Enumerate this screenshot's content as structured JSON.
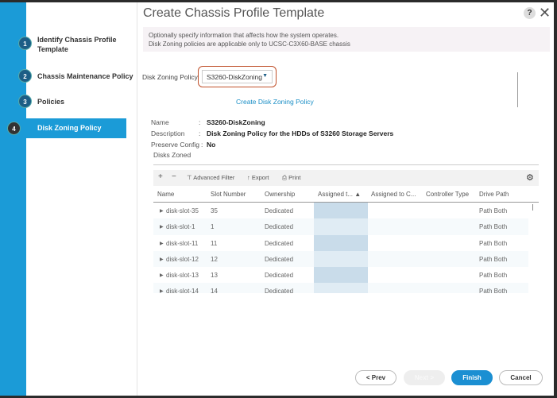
{
  "title": "Create Chassis Profile Template",
  "steps": [
    {
      "num": "1",
      "label": "Identify Chassis Profile Template"
    },
    {
      "num": "2",
      "label": "Chassis Maintenance Policy"
    },
    {
      "num": "3",
      "label": "Policies"
    },
    {
      "num": "4",
      "label": "Disk Zoning Policy"
    }
  ],
  "info": [
    "Optionally specify information that affects how the system operates.",
    "Disk Zoning policies are applicable only to UCSC-C3X60-BASE chassis"
  ],
  "dz_label": "Disk Zoning Policy",
  "dz_value": "S3260-DiskZoning",
  "create_link": "Create Disk Zoning Policy",
  "props": {
    "name_label": "Name",
    "name": "S3260-DiskZoning",
    "desc_label": "Description",
    "desc": "Disk Zoning Policy for the HDDs of S3260 Storage Servers",
    "preserve_label": "Preserve Config",
    "preserve": "No"
  },
  "disks_zoned": "Disks Zoned",
  "toolbar": {
    "add": "+",
    "remove": "−",
    "filter": "Advanced Filter",
    "export": "Export",
    "print": "Print"
  },
  "columns": [
    "Name",
    "Slot Number",
    "Ownership",
    "Assigned t... ▲",
    "Assigned to C...",
    "Controller Type",
    "Drive Path"
  ],
  "rows": [
    {
      "name": "disk-slot-35",
      "slot": "35",
      "own": "Dedicated",
      "path": "Path Both"
    },
    {
      "name": "disk-slot-1",
      "slot": "1",
      "own": "Dedicated",
      "path": "Path Both"
    },
    {
      "name": "disk-slot-11",
      "slot": "11",
      "own": "Dedicated",
      "path": "Path Both"
    },
    {
      "name": "disk-slot-12",
      "slot": "12",
      "own": "Dedicated",
      "path": "Path Both"
    },
    {
      "name": "disk-slot-13",
      "slot": "13",
      "own": "Dedicated",
      "path": "Path Both"
    },
    {
      "name": "disk-slot-14",
      "slot": "14",
      "own": "Dedicated",
      "path": "Path Both"
    }
  ],
  "buttons": {
    "prev": "< Prev",
    "next": "Next >",
    "finish": "Finish",
    "cancel": "Cancel"
  }
}
